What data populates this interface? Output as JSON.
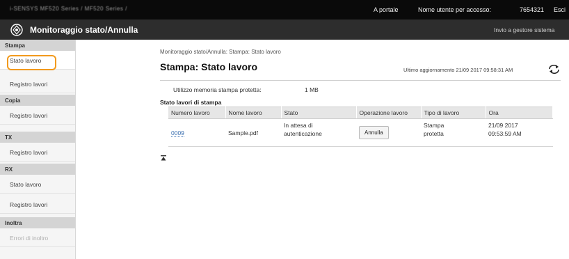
{
  "topbar": {
    "device": "i-SENSYS MF520 Series / MF520 Series /",
    "portal": "A portale",
    "user_label": "Nome utente per accesso:",
    "user_id": "7654321",
    "logout": "Esci"
  },
  "titlebar": {
    "title": "Monitoraggio stato/Annulla",
    "mail_admin": "Invio a gestore sistema"
  },
  "sidebar": {
    "sections": [
      {
        "label": "Stampa",
        "items": [
          {
            "label": "Stato lavoro",
            "active": true
          },
          {
            "label": "Registro lavori"
          }
        ]
      },
      {
        "label": "Copia",
        "items": [
          {
            "label": "Registro lavori"
          }
        ]
      },
      {
        "label": "TX",
        "items": [
          {
            "label": "Registro lavori"
          }
        ]
      },
      {
        "label": "RX",
        "items": [
          {
            "label": "Stato lavoro"
          },
          {
            "label": "Registro lavori"
          }
        ]
      },
      {
        "label": "Inoltra",
        "items": [
          {
            "label": "Errori di inoltro",
            "disabled": true
          }
        ]
      }
    ]
  },
  "main": {
    "breadcrumb": "Monitoraggio stato/Annulla: Stampa: Stato lavoro",
    "title": "Stampa: Stato lavoro",
    "updated": "Ultimo aggiornamento 21/09 2017 09:58:31 AM",
    "memory_label": "Utilizzo memoria stampa protetta:",
    "memory_value": "1 MB",
    "section_title": "Stato lavori di stampa",
    "table": {
      "headers": [
        "Numero lavoro",
        "Nome lavoro",
        "Stato",
        "Operazione lavoro",
        "Tipo di lavoro",
        "Ora"
      ],
      "rows": [
        {
          "number": "0009",
          "name": "Sample.pdf",
          "status_line1": "In attesa di",
          "status_line2": "autenticazione",
          "operation": "Annulla",
          "type_line1": "Stampa",
          "type_line2": "protetta",
          "time_line1": "21/09 2017",
          "time_line2": "09:53:59 AM"
        }
      ]
    }
  },
  "colors": {
    "topbar": "#0a0a0a",
    "titlebar": "#2d2d2d",
    "highlight": "#f29a1d",
    "link": "#3a6fb0"
  },
  "icons": {
    "logo": "canon-logo-icon",
    "refresh": "refresh-icon",
    "back_to_top": "back-to-top-icon"
  }
}
